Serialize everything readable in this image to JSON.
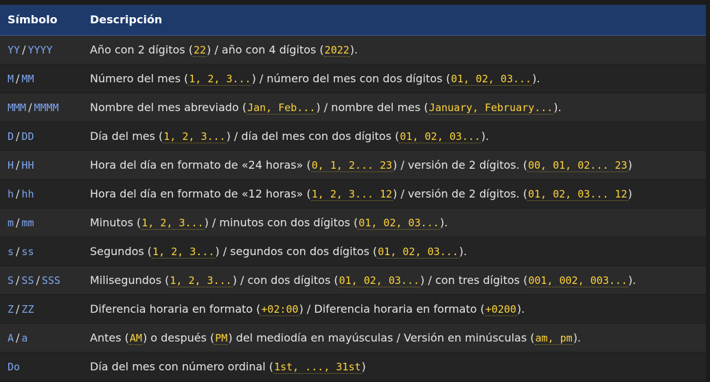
{
  "header": {
    "col1": "Símbolo",
    "col2": "Descripción"
  },
  "rows": [
    {
      "symbols": [
        "YY",
        "YYYY"
      ],
      "parts": [
        "Año con 2 dígitos (",
        "22",
        ") / año con 4 dígitos (",
        "2022",
        ")."
      ]
    },
    {
      "symbols": [
        "M",
        "MM"
      ],
      "parts": [
        "Número del mes (",
        "1, 2, 3...",
        ") / número del mes con dos dígitos (",
        "01, 02, 03...",
        ")."
      ]
    },
    {
      "symbols": [
        "MMM",
        "MMMM"
      ],
      "parts": [
        "Nombre del mes abreviado (",
        "Jan, Feb...",
        ") / nombre del mes (",
        "January, February...",
        ")."
      ]
    },
    {
      "symbols": [
        "D",
        "DD"
      ],
      "parts": [
        "Día del mes (",
        "1, 2, 3...",
        ") / día del mes con dos dígitos (",
        "01, 02, 03...",
        ")."
      ]
    },
    {
      "symbols": [
        "H",
        "HH"
      ],
      "parts": [
        "Hora del día en formato de «24 horas» (",
        "0, 1, 2... 23",
        ") / versión de 2 dígitos. (",
        "00, 01, 02... 23",
        ")"
      ]
    },
    {
      "symbols": [
        "h",
        "hh"
      ],
      "parts": [
        "Hora del día en formato de «12 horas» (",
        "1, 2, 3... 12",
        ") / versión de 2 dígitos. (",
        "01, 02, 03... 12",
        ")"
      ]
    },
    {
      "symbols": [
        "m",
        "mm"
      ],
      "parts": [
        "Minutos (",
        "1, 2, 3...",
        ") / minutos con dos dígitos (",
        "01, 02, 03...",
        ")."
      ]
    },
    {
      "symbols": [
        "s",
        "ss"
      ],
      "parts": [
        "Segundos (",
        "1, 2, 3...",
        ") / segundos con dos dígitos (",
        "01, 02, 03...",
        ")."
      ]
    },
    {
      "symbols": [
        "S",
        "SS",
        "SSS"
      ],
      "parts": [
        "Milisegundos (",
        "1, 2, 3...",
        ") / con dos dígitos (",
        "01, 02, 03...",
        ") / con tres dígitos (",
        "001, 002, 003...",
        ")."
      ]
    },
    {
      "symbols": [
        "Z",
        "ZZ"
      ],
      "parts": [
        "Diferencia horaria en formato (",
        "+02:00",
        ") / Diferencia horaria en formato (",
        "+0200",
        ")."
      ]
    },
    {
      "symbols": [
        "A",
        "a"
      ],
      "parts": [
        "Antes (",
        "AM",
        ") o después (",
        "PM",
        ") del mediodía en mayúsculas / Versión en minúsculas (",
        "am, pm",
        ")."
      ]
    },
    {
      "symbols": [
        "Do"
      ],
      "parts": [
        "Día del mes con número ordinal (",
        "1st, ..., 31st",
        ")"
      ]
    }
  ]
}
